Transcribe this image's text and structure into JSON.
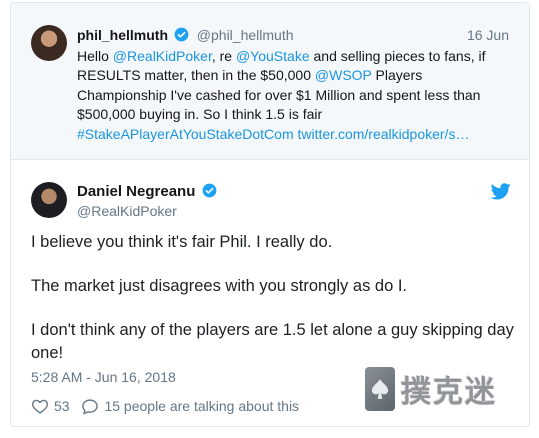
{
  "quoted_tweet": {
    "display_name": "phil_hellmuth",
    "handle": "@phil_hellmuth",
    "date": "16 Jun",
    "lines": [
      [
        {
          "text": "Hello ",
          "type": "text"
        },
        {
          "text": "@RealKidPoker",
          "type": "link"
        },
        {
          "text": ", re ",
          "type": "text"
        },
        {
          "text": "@YouStake",
          "type": "link"
        },
        {
          "text": " and selling pieces to fans, if",
          "type": "text"
        }
      ],
      [
        {
          "text": "RESULTS matter, then in the $50,000 ",
          "type": "text"
        },
        {
          "text": "@WSOP",
          "type": "link"
        },
        {
          "text": " Players",
          "type": "text"
        }
      ],
      [
        {
          "text": "Championship I've cashed for over $1 Million and spent less than",
          "type": "text"
        }
      ],
      [
        {
          "text": "$500,000 buying in.  So I think 1.5 is fair",
          "type": "text"
        }
      ],
      [
        {
          "text": "#StakeAPlayerAtYouStakeDotCom",
          "type": "link"
        },
        {
          "text": " ",
          "type": "text"
        },
        {
          "text": "twitter.com/realkidpoker/s…",
          "type": "link"
        }
      ]
    ]
  },
  "tweet": {
    "display_name": "Daniel Negreanu",
    "handle": "@RealKidPoker",
    "paragraph_1": "I believe you think it's fair Phil.  I really do.",
    "paragraph_2": "The market just disagrees with you strongly as do I.",
    "paragraph_3_line_1": "I don't think any of the players are 1.5 let alone a guy skipping day",
    "paragraph_3_line_2": "one!",
    "timestamp": "5:28 AM - Jun 16, 2018"
  },
  "actions": {
    "like_count": "53",
    "conversation_text": "15 people are talking about this"
  },
  "icons": {
    "verified": "verified-badge-icon",
    "twitter": "twitter-bird-icon",
    "like": "heart-icon",
    "reply": "speech-bubble-icon"
  },
  "colors": {
    "link": "#1b95e0",
    "verified": "#1da1f2",
    "muted": "#657786",
    "quoted_bg": "#f5f8fa"
  },
  "watermark": {
    "text": "撲克迷"
  }
}
